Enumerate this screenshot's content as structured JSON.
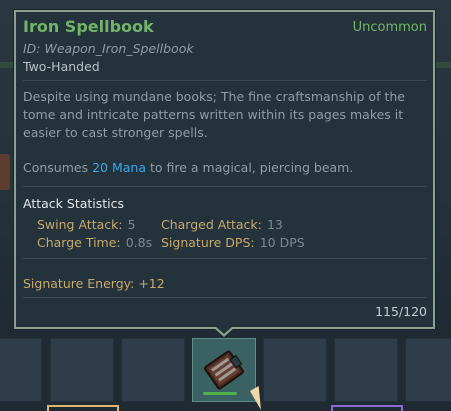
{
  "item": {
    "name": "Iron Spellbook",
    "rarity": "Uncommon",
    "id_line": "ID: Weapon_Iron_Spellbook",
    "handedness": "Two-Handed",
    "description": "Despite using mundane books; The fine craftsmanship of the tome and intricate patterns written within its pages makes it easier to cast stronger spells.",
    "consumes_prefix": "Consumes",
    "consumes_amount": "20 Mana",
    "consumes_suffix": "to fire a magical, piercing beam.",
    "stats_heading": "Attack Statistics",
    "stats": {
      "swing_label": "Swing Attack:",
      "swing_value": "5",
      "charged_label": "Charged Attack:",
      "charged_value": "13",
      "charge_time_label": "Charge Time:",
      "charge_time_value": "0.8s",
      "dps_label": "Signature DPS:",
      "dps_value": "10 DPS"
    },
    "signature_energy": "Signature Energy: +12",
    "durability_text": "115/120",
    "durability_fraction": 0.958
  },
  "colors": {
    "rarity_green": "#72b56a",
    "mana_blue": "#3aa7e6",
    "stat_gold": "#c7a96a",
    "tooltip_border": "#8ba08d"
  },
  "icons": {
    "held_item": "spellbook-icon",
    "cursor": "pointer-cursor-icon"
  }
}
